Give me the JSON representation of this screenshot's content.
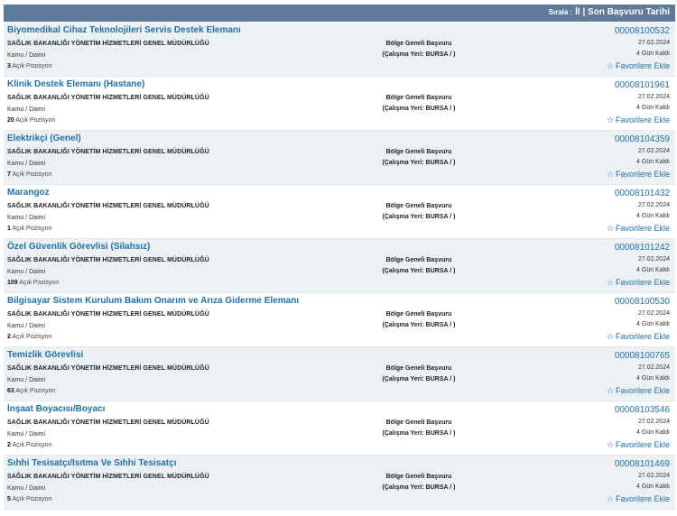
{
  "header": {
    "sort_label": "Sırala :",
    "sort_il": "İl",
    "separator": "|",
    "sort_date": "Son Başvuru Tarihi"
  },
  "listings": [
    {
      "title": "Biyomedikal Cihaz Teknolojileri Servis Destek Elemanı",
      "org": "SAĞLIK BAKANLIĞI YÖNETİM HİZMETLERİ GENEL MÜDÜRLÜĞÜ",
      "kind": "Kamu / Daimi",
      "count": "3",
      "count_suffix": "Açık Pozisyon",
      "region": "Bölge Geneli Başvuru",
      "location": "(Çalışma Yeri: BURSA / )",
      "code": "00008100532",
      "date": "27.02.2024",
      "days": "4 Gün Kaldı",
      "fav": "Favorilere Ekle"
    },
    {
      "title": "Klinik Destek Elemanı (Hastane)",
      "org": "SAĞLIK BAKANLIĞI YÖNETİM HİZMETLERİ GENEL MÜDÜRLÜĞÜ",
      "kind": "Kamu / Daimi",
      "count": "20",
      "count_suffix": "Açık Pozisyon",
      "region": "Bölge Geneli Başvuru",
      "location": "(Çalışma Yeri: BURSA / )",
      "code": "00008101961",
      "date": "27.02.2024",
      "days": "4 Gün Kaldı",
      "fav": "Favorilere Ekle"
    },
    {
      "title": "Elektrikçi (Genel)",
      "org": "SAĞLIK BAKANLIĞI YÖNETİM HİZMETLERİ GENEL MÜDÜRLÜĞÜ",
      "kind": "Kamu / Daimi",
      "count": "7",
      "count_suffix": "Açık Pozisyon",
      "region": "Bölge Geneli Başvuru",
      "location": "(Çalışma Yeri: BURSA / )",
      "code": "00008104359",
      "date": "27.02.2024",
      "days": "4 Gün Kaldı",
      "fav": "Favorilere Ekle"
    },
    {
      "title": "Marangoz",
      "org": "SAĞLIK BAKANLIĞI YÖNETİM HİZMETLERİ GENEL MÜDÜRLÜĞÜ",
      "kind": "Kamu / Daimi",
      "count": "1",
      "count_suffix": "Açık Pozisyon",
      "region": "Bölge Geneli Başvuru",
      "location": "(Çalışma Yeri: BURSA / )",
      "code": "00008101432",
      "date": "27.02.2024",
      "days": "4 Gün Kaldı",
      "fav": "Favorilere Ekle"
    },
    {
      "title": "Özel Güvenlik Görevlisi (Silahsız)",
      "org": "SAĞLIK BAKANLIĞI YÖNETİM HİZMETLERİ GENEL MÜDÜRLÜĞÜ",
      "kind": "Kamu / Daimi",
      "count": "109",
      "count_suffix": "Açık Pozisyon",
      "region": "Bölge Geneli Başvuru",
      "location": "(Çalışma Yeri: BURSA / )",
      "code": "00008101242",
      "date": "27.02.2024",
      "days": "4 Gün Kaldı",
      "fav": "Favorilere Ekle"
    },
    {
      "title": "Bilgisayar Sistem Kurulum Bakım Onarım ve Arıza Giderme Elemanı",
      "org": "SAĞLIK BAKANLIĞI YÖNETİM HİZMETLERİ GENEL MÜDÜRLÜĞÜ",
      "kind": "Kamu / Daimi",
      "count": "2",
      "count_suffix": "Açık Pozisyon",
      "region": "Bölge Geneli Başvuru",
      "location": "(Çalışma Yeri: BURSA / )",
      "code": "00008100530",
      "date": "27.02.2024",
      "days": "4 Gün Kaldı",
      "fav": "Favorilere Ekle"
    },
    {
      "title": "Temizlik Görevlisi",
      "org": "SAĞLIK BAKANLIĞI YÖNETİM HİZMETLERİ GENEL MÜDÜRLÜĞÜ",
      "kind": "Kamu / Daimi",
      "count": "63",
      "count_suffix": "Açık Pozisyon",
      "region": "Bölge Geneli Başvuru",
      "location": "(Çalışma Yeri: BURSA / )",
      "code": "00008100765",
      "date": "27.02.2024",
      "days": "4 Gün Kaldı",
      "fav": "Favorilere Ekle"
    },
    {
      "title": "İnşaat Boyacısı/Boyacı",
      "org": "SAĞLIK BAKANLIĞI YÖNETİM HİZMETLERİ GENEL MÜDÜRLÜĞÜ",
      "kind": "Kamu / Daimi",
      "count": "2",
      "count_suffix": "Açık Pozisyon",
      "region": "Bölge Geneli Başvuru",
      "location": "(Çalışma Yeri: BURSA / )",
      "code": "00008103546",
      "date": "27.02.2024",
      "days": "4 Gün Kaldı",
      "fav": "Favorilere Ekle"
    },
    {
      "title": "Sıhhi Tesisatçı/Isıtma Ve Sıhhi Tesisatçı",
      "org": "SAĞLIK BAKANLIĞI YÖNETİM HİZMETLERİ GENEL MÜDÜRLÜĞÜ",
      "kind": "Kamu / Daimi",
      "count": "5",
      "count_suffix": "Açık Pozisyon",
      "region": "Bölge Geneli Başvuru",
      "location": "(Çalışma Yeri: BURSA / )",
      "code": "00008101469",
      "date": "27.02.2024",
      "days": "4 Gün Kaldı",
      "fav": "Favorilere Ekle"
    }
  ],
  "icons": {
    "favorite": "star-outline-icon"
  },
  "colors": {
    "header_bg": "#5f7b99",
    "link": "#1f6fa8",
    "alt_row": "#eef1f4"
  }
}
